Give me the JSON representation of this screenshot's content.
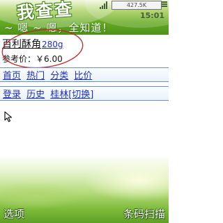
{
  "header": {
    "app_title": "我查查",
    "slogan": "~ 嗯 ~ 嗯，全知道！",
    "data_counter": "427.5K",
    "clock": "15:01"
  },
  "product": {
    "name": "百利酥角",
    "weight": "280g",
    "price_label": "参考价：",
    "price_value": "￥6.00"
  },
  "nav_row_1": [
    "首页",
    "热门",
    "分类",
    "比价"
  ],
  "nav_row_2": [
    "登录",
    "历史",
    "桂林[切换]"
  ],
  "softkeys": {
    "left": "选项",
    "right": "条码扫描"
  },
  "colors": {
    "header_green": "#67ab22",
    "link_blue": "#1d2fbf",
    "annotation_red": "#c0262b"
  }
}
